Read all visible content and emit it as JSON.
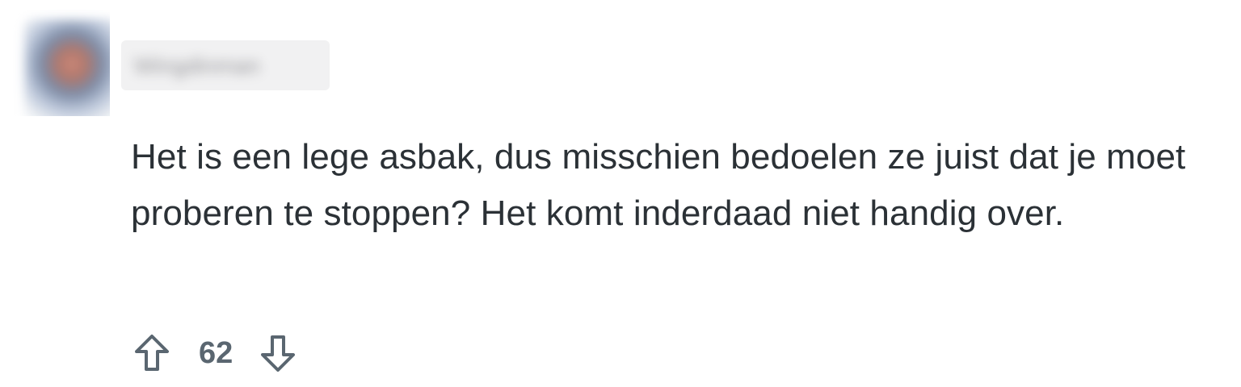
{
  "comment": {
    "username": "Wingdinman",
    "body": "Het is een lege asbak, dus misschien bedoelen ze juist dat je moet proberen te stoppen? Het komt inderdaad niet handig over.",
    "score": "62",
    "icons": {
      "avatar": "avatar",
      "upvote": "upvote-arrow-icon",
      "downvote": "downvote-arrow-icon"
    },
    "colors": {
      "text": "#2b3136",
      "score": "#5a6670",
      "icon": "#5a6670"
    }
  }
}
